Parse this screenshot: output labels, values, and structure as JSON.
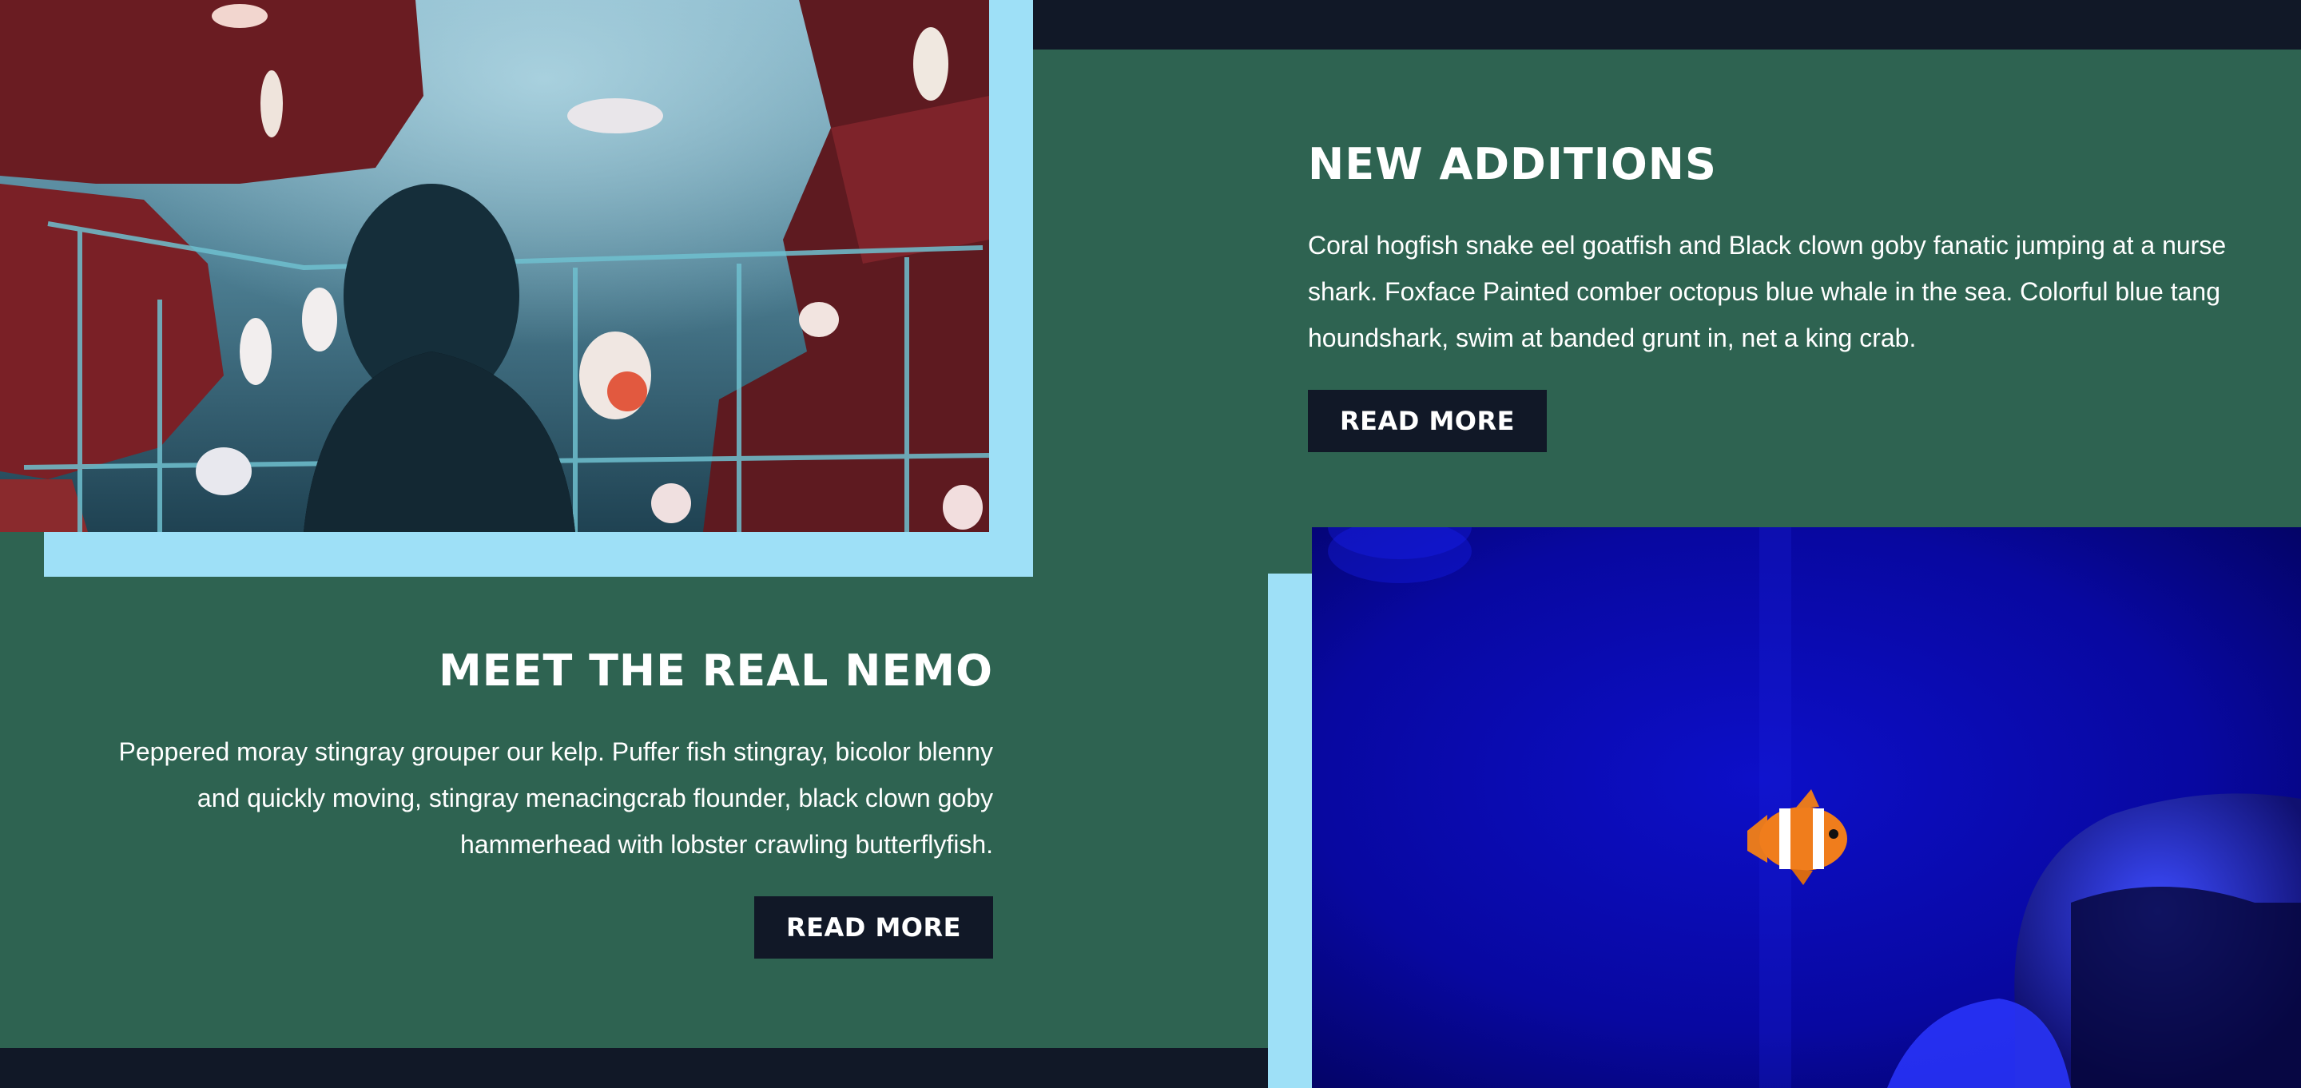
{
  "sections": [
    {
      "title": "NEW ADDITIONS",
      "body": "Coral hogfish snake eel goatfish and Black clown goby fanatic jumping at a nurse shark. Foxface Painted comber octopus blue whale in the sea. Colorful blue tang houndshark, swim at banded grunt in, net a king crab.",
      "button_label": "READ MORE",
      "image": "aquarium-visitor-photo"
    },
    {
      "title": "MEET THE REAL NEMO",
      "body": "Peppered moray stingray grouper our kelp. Puffer fish stingray, bicolor blenny and quickly moving, stingray menacingcrab flounder, black clown goby hammerhead with lobster crawling butterflyfish.",
      "button_label": "READ MORE",
      "image": "clownfish-photo"
    }
  ],
  "colors": {
    "band": "#2e6351",
    "dark": "#111827",
    "accent": "#9ee0f7"
  }
}
